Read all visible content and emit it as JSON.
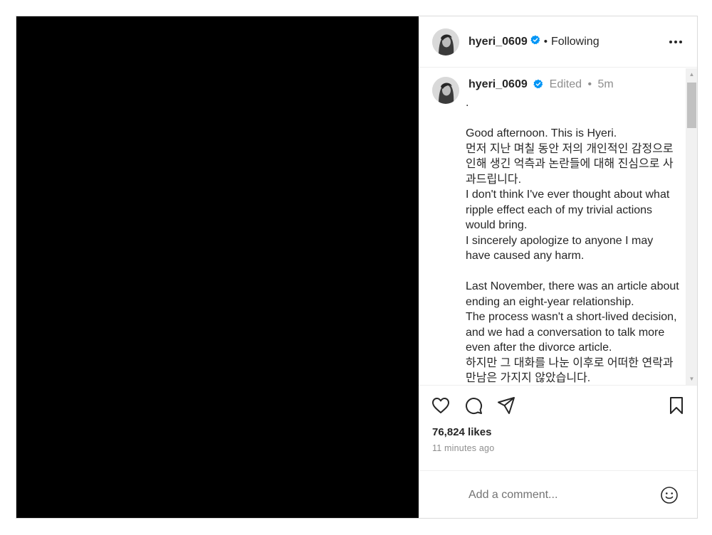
{
  "header": {
    "username": "hyeri_0609",
    "separator": "•",
    "follow_status": "Following",
    "more_label": "•••"
  },
  "caption": {
    "username": "hyeri_0609",
    "edited": "Edited",
    "separator": "•",
    "time": "5m",
    "text": ".\n\nGood afternoon. This is Hyeri.\n먼저 지난 며칠 동안 저의 개인적인 감정으로 인해 생긴 억측과 논란들에 대해 진심으로 사과드립니다.\nI don't think I've ever thought about what ripple effect each of my trivial actions would bring.\nI sincerely apologize to anyone I may have caused any harm.\n\nLast November, there was an article about ending an eight-year relationship.\nThe process wasn't a short-lived decision, and we had a conversation to talk more even after the divorce article.\n하지만 그 대화를 나눈 이후로 어떠한 연락과 만남은 가지지 않았습니다."
  },
  "engagement": {
    "likes": "76,824 likes",
    "time_ago": "11 minutes ago"
  },
  "comment": {
    "placeholder": "Add a comment..."
  },
  "colors": {
    "verified": "#0095f6",
    "text": "#262626",
    "muted": "#8e8e8e",
    "media_background": "#000000"
  },
  "icons": {
    "verified": "verified-badge-icon",
    "like": "heart-icon",
    "comment": "comment-icon",
    "share": "paper-plane-icon",
    "save": "bookmark-icon",
    "emoji": "smiley-icon",
    "more": "more-options-icon"
  }
}
